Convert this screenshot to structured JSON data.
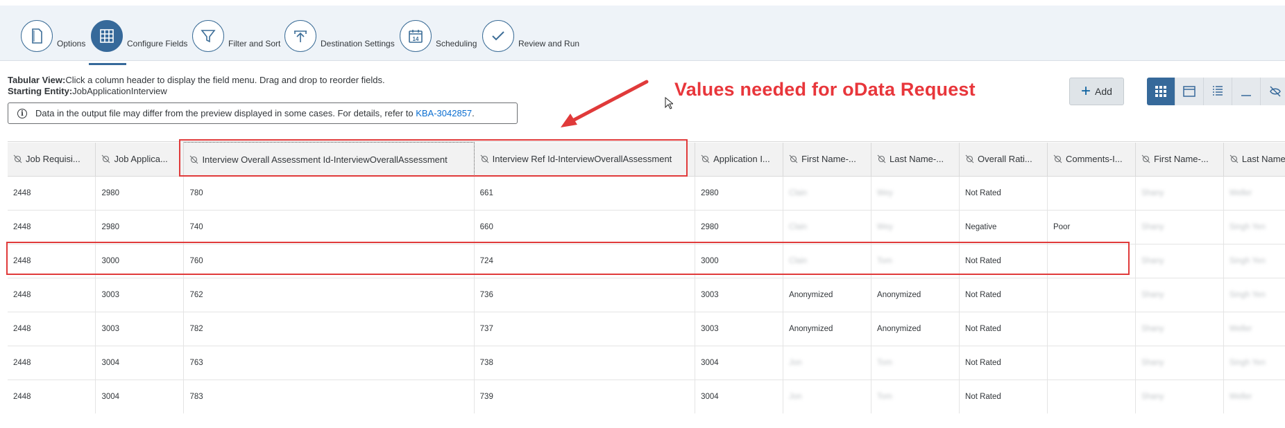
{
  "wizard": {
    "steps": [
      {
        "label": "Options",
        "icon": "document-icon",
        "active": false
      },
      {
        "label": "Configure Fields",
        "icon": "table-grid-icon",
        "active": true
      },
      {
        "label": "Filter and Sort",
        "icon": "funnel-icon",
        "active": false
      },
      {
        "label": "Destination Settings",
        "icon": "upload-icon",
        "active": false
      },
      {
        "label": "Scheduling",
        "icon": "calendar-icon",
        "active": false
      },
      {
        "label": "Review and Run",
        "icon": "checkmark-icon",
        "active": false
      }
    ],
    "calendar_day": "14"
  },
  "info": {
    "view_label": "Tabular View:",
    "view_text": "Click a column header to display the field menu. Drag and drop to reorder fields.",
    "entity_label": "Starting Entity:",
    "entity_value": "JobApplicationInterview",
    "notice_text": "Data in the output file may differ from the preview displayed in some cases. For details, refer to ",
    "notice_link": "KBA-3042857",
    "notice_suffix": "."
  },
  "annotation": {
    "text": "Values needed for oData Request",
    "color": "#e8363b"
  },
  "toolbar": {
    "add_label": "Add",
    "view_icons": [
      "grid-view-icon",
      "panel-view-icon",
      "list-view-icon",
      "minimize-icon",
      "hide-icon"
    ]
  },
  "table": {
    "headers": [
      "Job Requisi...",
      "Job Applica...",
      "Interview Overall Assessment Id-InterviewOverallAssessment",
      "Interview Ref Id-InterviewOverallAssessment",
      "Application I...",
      "First Name-...",
      "Last Name-...",
      "Overall Rati...",
      "Comments-I...",
      "First Name-...",
      "Last Name-..."
    ],
    "rows": [
      [
        "2448",
        "2980",
        "780",
        "661",
        "2980",
        "Clain",
        "Wey",
        "Not Rated",
        "",
        "Shany",
        "Weller"
      ],
      [
        "2448",
        "2980",
        "740",
        "660",
        "2980",
        "Clain",
        "Wey",
        "Negative",
        "Poor",
        "Shany",
        "Singh Yen"
      ],
      [
        "2448",
        "3000",
        "760",
        "724",
        "3000",
        "Clain",
        "Tom",
        "Not Rated",
        "",
        "Shany",
        "Singh Yen"
      ],
      [
        "2448",
        "3003",
        "762",
        "736",
        "3003",
        "Anonymized",
        "Anonymized",
        "Not Rated",
        "",
        "Shany",
        "Singh Yen"
      ],
      [
        "2448",
        "3003",
        "782",
        "737",
        "3003",
        "Anonymized",
        "Anonymized",
        "Not Rated",
        "",
        "Shany",
        "Weller"
      ],
      [
        "2448",
        "3004",
        "763",
        "738",
        "3004",
        "Jon",
        "Tom",
        "Not Rated",
        "",
        "Shany",
        "Singh Yen"
      ],
      [
        "2448",
        "3004",
        "783",
        "739",
        "3004",
        "Jon",
        "Tom",
        "Not Rated",
        "",
        "Shany",
        "Weller"
      ]
    ],
    "blurred_cells": [
      [
        0,
        5
      ],
      [
        0,
        6
      ],
      [
        0,
        9
      ],
      [
        0,
        10
      ],
      [
        1,
        5
      ],
      [
        1,
        6
      ],
      [
        1,
        9
      ],
      [
        1,
        10
      ],
      [
        2,
        5
      ],
      [
        2,
        6
      ],
      [
        2,
        9
      ],
      [
        2,
        10
      ],
      [
        3,
        9
      ],
      [
        3,
        10
      ],
      [
        4,
        9
      ],
      [
        4,
        10
      ],
      [
        5,
        5
      ],
      [
        5,
        6
      ],
      [
        5,
        9
      ],
      [
        5,
        10
      ],
      [
        6,
        5
      ],
      [
        6,
        6
      ],
      [
        6,
        9
      ],
      [
        6,
        10
      ]
    ]
  }
}
